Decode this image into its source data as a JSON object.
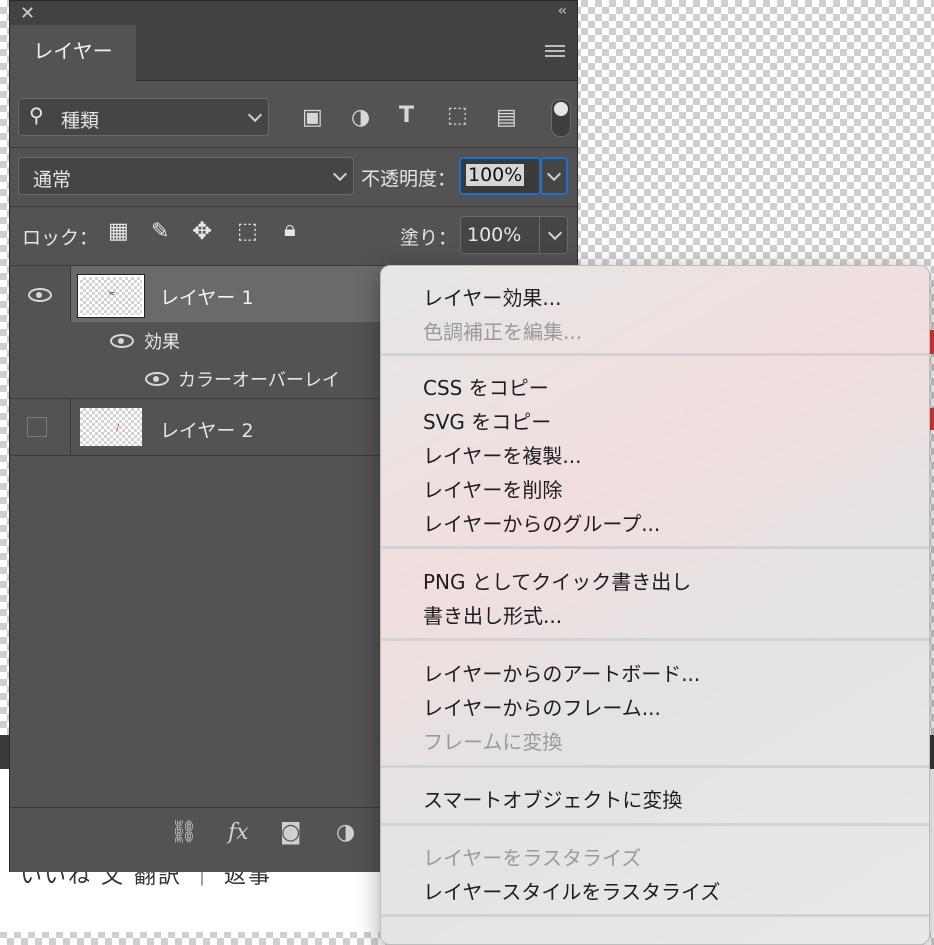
{
  "panel": {
    "tab_label": "レイヤー",
    "filter": {
      "label": "種類"
    },
    "blend_mode": "通常",
    "opacity": {
      "label": "不透明度：",
      "value": "100%"
    },
    "lock": {
      "label": "ロック："
    },
    "fill": {
      "label": "塗り：",
      "value": "100%"
    },
    "layers": [
      {
        "name": "レイヤー 1",
        "visible": true,
        "selected": true
      },
      {
        "name": "レイヤー 2",
        "visible": false,
        "selected": false
      }
    ],
    "effects": {
      "label": "効果",
      "items": [
        "カラーオーバーレイ"
      ]
    }
  },
  "background": {
    "partial_text": "いいね  文 翻訳 ｜ 返事"
  },
  "context_menu": {
    "items": [
      {
        "label": "レイヤー効果...",
        "enabled": true
      },
      {
        "label": "色調補正を編集...",
        "enabled": false
      },
      {
        "label": "CSS をコピー",
        "enabled": true
      },
      {
        "label": "SVG をコピー",
        "enabled": true
      },
      {
        "label": "レイヤーを複製...",
        "enabled": true
      },
      {
        "label": "レイヤーを削除",
        "enabled": true
      },
      {
        "label": "レイヤーからのグループ...",
        "enabled": true
      },
      {
        "label": "PNG としてクイック書き出し",
        "enabled": true
      },
      {
        "label": "書き出し形式...",
        "enabled": true
      },
      {
        "label": "レイヤーからのアートボード...",
        "enabled": true
      },
      {
        "label": "レイヤーからのフレーム...",
        "enabled": true
      },
      {
        "label": "フレームに変換",
        "enabled": false
      },
      {
        "label": "スマートオブジェクトに変換",
        "enabled": true
      },
      {
        "label": "レイヤーをラスタライズ",
        "enabled": false
      },
      {
        "label": "レイヤースタイルをラスタライズ",
        "enabled": true
      }
    ]
  },
  "colors": {
    "panel_bg": "#535353",
    "accent_focus": "#1d6fd6",
    "menu_text": "#1d1d1d",
    "menu_disabled": "#9a9a9a"
  }
}
